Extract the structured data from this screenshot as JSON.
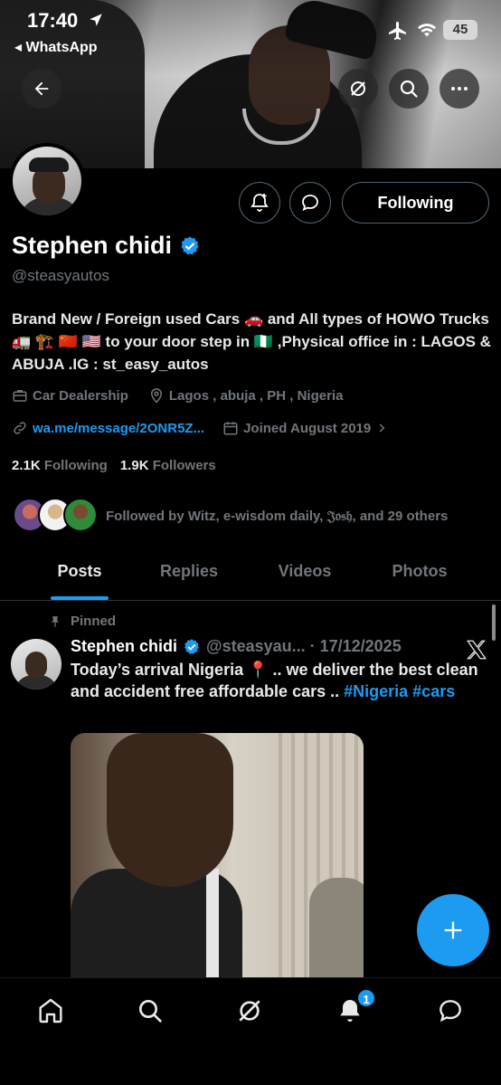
{
  "status_bar": {
    "time": "17:40",
    "back_app": "◂ WhatsApp",
    "battery": "45"
  },
  "profile": {
    "name": "Stephen chidi",
    "handle": "@steasyautos",
    "verified": true,
    "bio": "Brand New / Foreign used Cars 🚗 and All types of HOWO Trucks 🚛 🏗️ 🇨🇳 🇺🇸 to your door step in 🇳🇬 ,Physical office in : LAGOS & ABUJA .IG : st_easy_autos",
    "category": "Car Dealership",
    "location": "Lagos , abuja , PH , Nigeria",
    "website": "wa.me/message/2ONR5Z...",
    "joined": "Joined August 2019",
    "following_count": "2.1K",
    "following_label": "Following",
    "followers_count": "1.9K",
    "followers_label": "Followers",
    "followed_by": "Followed by Witz, e-wisdom daily, 𝔍𝔬𝔰𝔥, and 29 others",
    "follow_button": "Following"
  },
  "tabs": [
    {
      "label": "Posts",
      "active": true
    },
    {
      "label": "Replies",
      "active": false
    },
    {
      "label": "Videos",
      "active": false
    },
    {
      "label": "Photos",
      "active": false
    }
  ],
  "post": {
    "pinned_label": "Pinned",
    "author": "Stephen chidi",
    "handle_date": "@steasyau... · 17/12/2025",
    "text": "Today’s arrival Nigeria 📍 .. we deliver the best clean and accident free affordable cars .. ",
    "hashtag1": "#Nigeria",
    "hashtag2": "#cars"
  },
  "bottom_nav": {
    "notification_badge": "1"
  },
  "colors": {
    "accent": "#1d9bf0",
    "muted": "#71767b",
    "border": "#2f3336"
  }
}
